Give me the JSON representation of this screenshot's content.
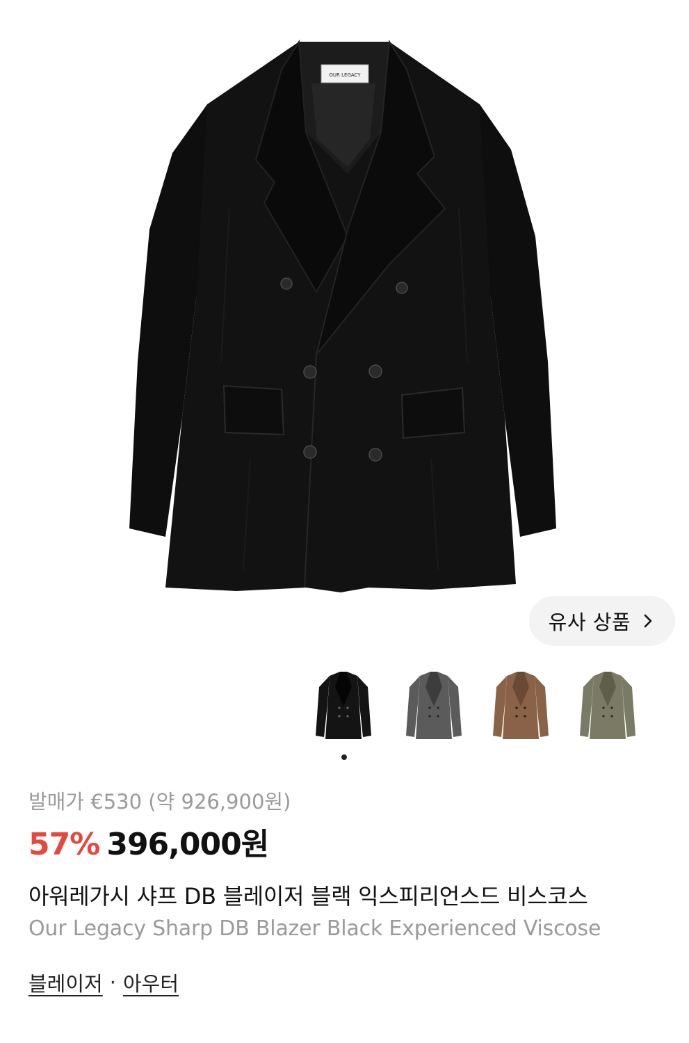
{
  "hero": {
    "image_icon": "double-breasted-black-blazer",
    "brand_label": "OUR LEGACY"
  },
  "similar": {
    "label": "유사 상품",
    "icon": "chevron-right-icon"
  },
  "thumbnails": [
    {
      "name": "black",
      "color": "#141414",
      "shade": "#050505"
    },
    {
      "name": "charcoal",
      "color": "#5b5b5b",
      "shade": "#3d3d3d"
    },
    {
      "name": "brown",
      "color": "#8a6248",
      "shade": "#6b4a35"
    },
    {
      "name": "olive",
      "color": "#7b7a64",
      "shade": "#5f5e4b"
    }
  ],
  "gallery_index": {
    "current": 1,
    "total": 1
  },
  "pricing": {
    "release_price": "발매가 €530 (약 926,900원)",
    "discount": "57%",
    "price": "396,000원",
    "accent_color": "#e5483d"
  },
  "product": {
    "name_ko": "아워레가시 샤프 DB 블레이저 블랙 익스피리언스드 비스코스",
    "name_en": "Our Legacy Sharp DB Blazer Black Experienced Viscose"
  },
  "categories": {
    "items": [
      "블레이저",
      "아우터"
    ],
    "separator": "·"
  }
}
